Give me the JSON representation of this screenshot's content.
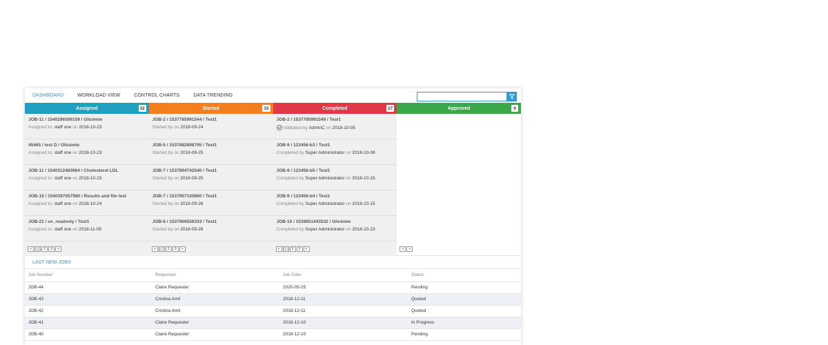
{
  "nav": {
    "tabs": [
      "DASHBOARD",
      "WORKLOAD VIEW",
      "CONTROL CHARTS",
      "DATA TRENDING"
    ],
    "search_placeholder": ""
  },
  "columns": [
    {
      "title": "Assigned",
      "count": "32",
      "color": "#1fa0c0",
      "cards": [
        {
          "title": "JOB-11 / 1540296599159 / Glicémie",
          "prefix": "Assigned to:",
          "who": "staff one",
          "mid": "on",
          "date": "2018-10-23"
        },
        {
          "title": "45465 / test D / Glicémie",
          "prefix": "Assigned to:",
          "who": "staff one",
          "mid": "on",
          "date": "2018-10-23"
        },
        {
          "title": "JOB-11 / 1540312483964 / Cholesterol LDL",
          "prefix": "Assigned to:",
          "who": "staff one",
          "mid": "on",
          "date": "2018-10-23"
        },
        {
          "title": "JOB-15 / 1540397057980 / Results and file test",
          "prefix": "Assigned to:",
          "who": "staff one",
          "mid": "on",
          "date": "2018-10-24"
        },
        {
          "title": "JOB-21 / sn_readonly / Test1",
          "prefix": "Assigned to:",
          "who": "staff one",
          "mid": "on",
          "date": "2018-11-05"
        }
      ],
      "pager": [
        "«",
        "",
        "2",
        "3",
        "»"
      ]
    },
    {
      "title": "Started",
      "count": "15",
      "color": "#f47f1f",
      "cards": [
        {
          "title": "JOB-2 / 1537785991544 / Test1",
          "prefix": "Started by",
          "who": "",
          "mid": "on",
          "date": "2018-09-24"
        },
        {
          "title": "JOB-5 / 1537882898795 / Test1",
          "prefix": "Started by",
          "who": "",
          "mid": "on",
          "date": "2018-09-25"
        },
        {
          "title": "JOB-7 / 1537894742540 / Test1",
          "prefix": "Started by",
          "who": "",
          "mid": "on",
          "date": "2018-09-25"
        },
        {
          "title": "JOB-7 / 1537957100860 / Test1",
          "prefix": "Started by",
          "who": "",
          "mid": "on",
          "date": "2018-09-26"
        },
        {
          "title": "JOB-8 / 1537966556333 / Test1",
          "prefix": "Started by",
          "who": "",
          "mid": "on",
          "date": "2018-09-26"
        }
      ],
      "pager": [
        "«",
        "",
        "2",
        "3",
        "»"
      ]
    },
    {
      "title": "Completed",
      "count": "27",
      "color": "#e0394a",
      "cards": [
        {
          "title": "JOB-2 / 1537785991549 / Test1",
          "prefix": "Validated by",
          "who": "AdminC",
          "mid": "on",
          "date": "2018-10-05",
          "validated": true
        },
        {
          "title": "JOB-9 / 123456-b3 / Test1",
          "prefix": "Completed by",
          "who": "Super Administrator",
          "mid": "on",
          "date": "2018-10-08"
        },
        {
          "title": "JOB-9 / 123456-b5 / Test1",
          "prefix": "Completed by",
          "who": "Super Administrator",
          "mid": "on",
          "date": "2018-10-15"
        },
        {
          "title": "JOB-9 / 123456-b4 / Test1",
          "prefix": "Completed by",
          "who": "Super Administrator",
          "mid": "on",
          "date": "2018-10-15"
        },
        {
          "title": "JOB-10 / 1539851443532 / Glicémie",
          "prefix": "Completed by",
          "who": "Super Administrator",
          "mid": "on",
          "date": "2018-10-23"
        }
      ],
      "pager": [
        "«",
        "",
        "2",
        "3",
        "»"
      ]
    },
    {
      "title": "Approved",
      "count": "0",
      "color": "#3aa84a",
      "cards": [],
      "pager": [
        "«",
        "»"
      ]
    }
  ],
  "jobs": {
    "title": "LAST NEW JOBS",
    "headers": [
      "Job Number",
      "Requester",
      "Job Date",
      "Status"
    ],
    "rows": [
      [
        "JOB-44",
        "Claire Requester",
        "2020-05-25",
        "Pending"
      ],
      [
        "JOB-43",
        "Cristina Amil",
        "2018-12-11",
        "Quoted"
      ],
      [
        "JOB-42",
        "Cristina Amil",
        "2018-12-11",
        "Quoted"
      ],
      [
        "JOB-41",
        "Claire Requester",
        "2018-12-10",
        "In Progress"
      ],
      [
        "JOB-40",
        "Claire Requester",
        "2018-12-10",
        "Pending"
      ]
    ]
  }
}
